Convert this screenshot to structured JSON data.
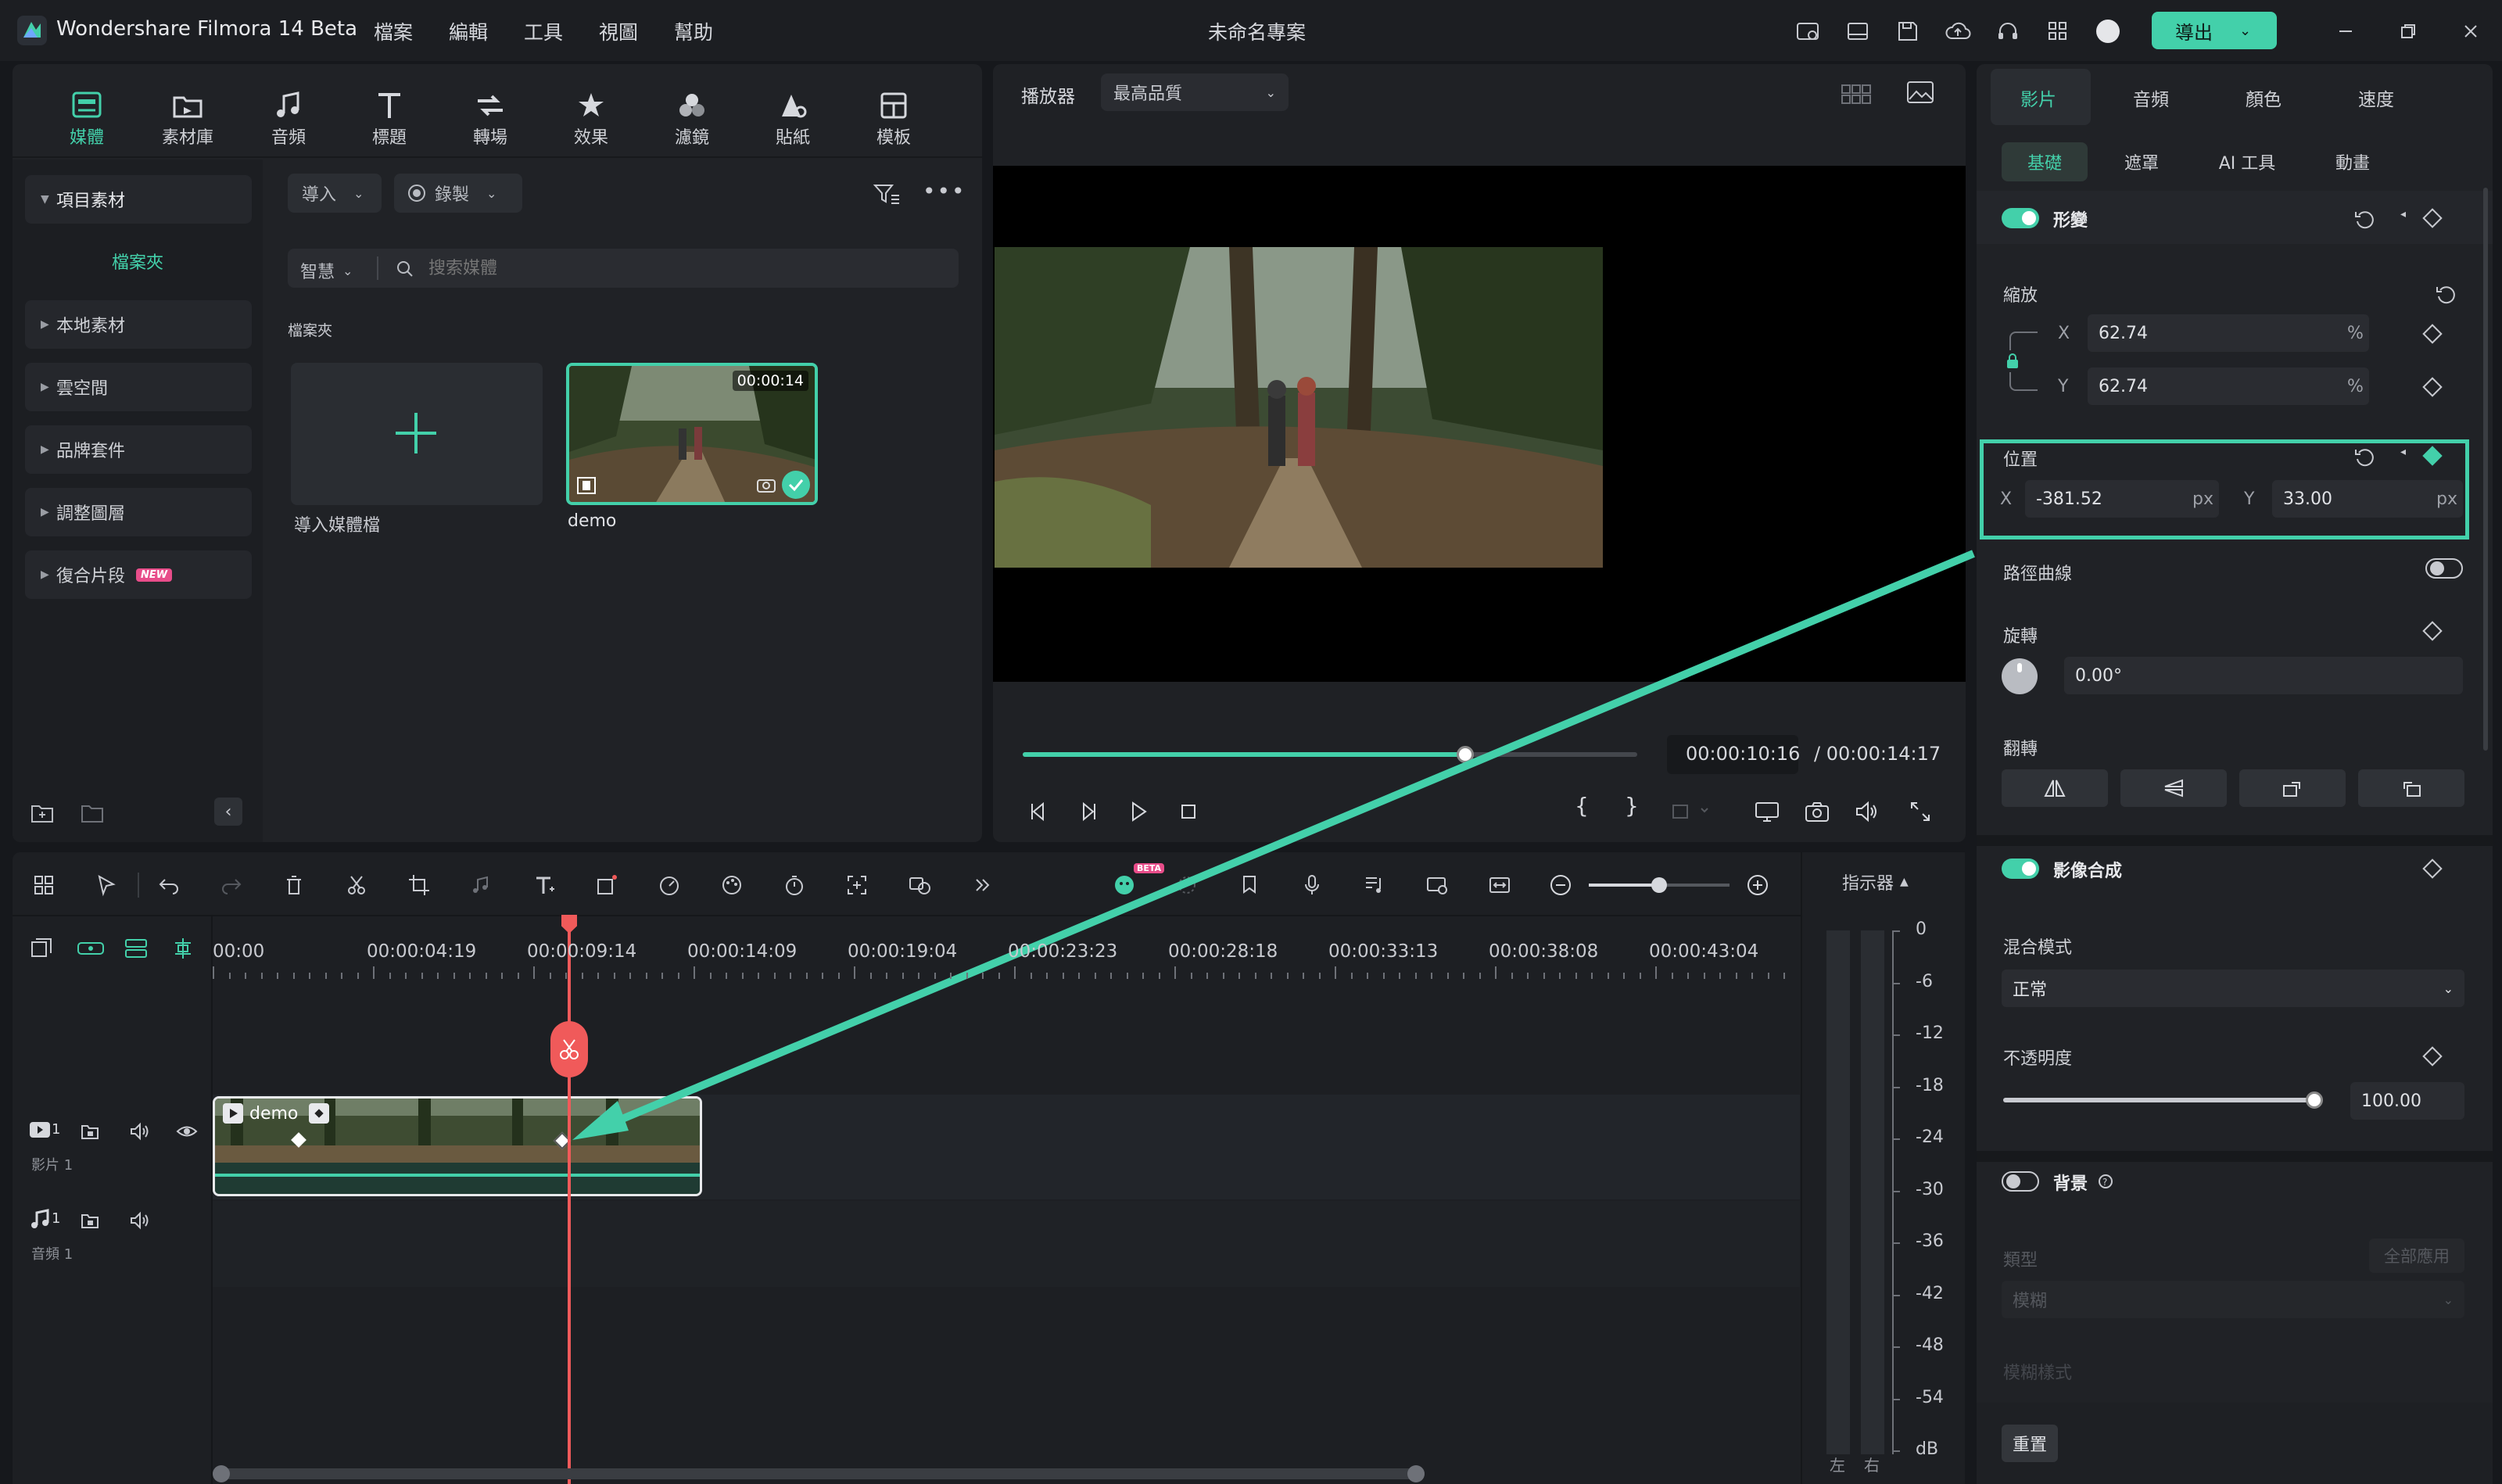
{
  "app": {
    "title": "Wondershare Filmora 14 Beta",
    "project_title": "未命名專案",
    "export_label": "導出"
  },
  "menu": [
    "檔案",
    "編輯",
    "工具",
    "視圖",
    "幫助"
  ],
  "media_tabs": [
    {
      "label": "媒體",
      "icon": "media-icon",
      "active": true
    },
    {
      "label": "素材庫",
      "icon": "library-icon"
    },
    {
      "label": "音頻",
      "icon": "music-note-icon"
    },
    {
      "label": "標題",
      "icon": "title-text-icon"
    },
    {
      "label": "轉場",
      "icon": "transition-icon"
    },
    {
      "label": "效果",
      "icon": "effects-star-icon"
    },
    {
      "label": "濾鏡",
      "icon": "filter-icon"
    },
    {
      "label": "貼紙",
      "icon": "sticker-icon"
    },
    {
      "label": "模板",
      "icon": "template-icon"
    }
  ],
  "sidebar": {
    "project_media": "項目素材",
    "folder": "檔案夾",
    "items": [
      {
        "label": "本地素材"
      },
      {
        "label": "雲空間"
      },
      {
        "label": "品牌套件"
      },
      {
        "label": "調整圖層"
      },
      {
        "label": "復合片段",
        "badge": "NEW"
      }
    ]
  },
  "media_toolbar": {
    "import_label": "導入",
    "record_label": "錄製",
    "smart_label": "智慧",
    "search_placeholder": "搜索媒體",
    "folder_heading": "檔案夾"
  },
  "media_items": [
    {
      "label": "導入媒體檔",
      "type": "import"
    },
    {
      "label": "demo",
      "duration": "00:00:14",
      "selected": true
    }
  ],
  "player": {
    "label": "播放器",
    "quality": "最高品質",
    "current_time": "00:00:10:16",
    "total_time": "/ 00:00:14:17",
    "progress": 0.72
  },
  "properties": {
    "tabs": [
      "影片",
      "音頻",
      "顏色",
      "速度"
    ],
    "subtabs": [
      "基礎",
      "遮罩",
      "AI 工具",
      "動畫"
    ],
    "transform": {
      "title": "形變",
      "scale_label": "縮放",
      "scale_x": "62.74",
      "scale_y": "62.74",
      "percent": "%",
      "position_label": "位置",
      "pos_x": "-381.52",
      "pos_y": "33.00",
      "px": "px",
      "x": "X",
      "y": "Y",
      "path_curve_label": "路徑曲線",
      "rotate_label": "旋轉",
      "rotate_value": "0.00°",
      "flip_label": "翻轉"
    },
    "compositing": {
      "title": "影像合成",
      "blend_label": "混合模式",
      "blend_value": "正常",
      "opacity_label": "不透明度",
      "opacity_value": "100.00",
      "opacity": 1.0
    },
    "background": {
      "title": "背景",
      "type_label": "類型",
      "apply_all": "全部應用",
      "type_value": "模糊",
      "style_label": "模糊樣式"
    },
    "reset_label": "重置",
    "accent": "#43d0aa"
  },
  "timeline": {
    "ruler": [
      "00:00",
      "00:00:04:19",
      "00:00:09:14",
      "00:00:14:09",
      "00:00:19:04",
      "00:00:23:23",
      "00:00:28:18",
      "00:00:33:13",
      "00:00:38:08",
      "00:00:43:04"
    ],
    "indicator_label": "指示器",
    "beta": "BETA",
    "video_track": {
      "number": "1",
      "name": "影片 1"
    },
    "audio_track": {
      "number": "1",
      "name": "音頻 1"
    },
    "clip_label": "demo",
    "db_labels": [
      "0",
      "-6",
      "-12",
      "-18",
      "-24",
      "-30",
      "-36",
      "-42",
      "-48",
      "-54",
      "dB"
    ],
    "lr": [
      "左",
      "右"
    ],
    "playhead_color": "#f05a5a"
  }
}
